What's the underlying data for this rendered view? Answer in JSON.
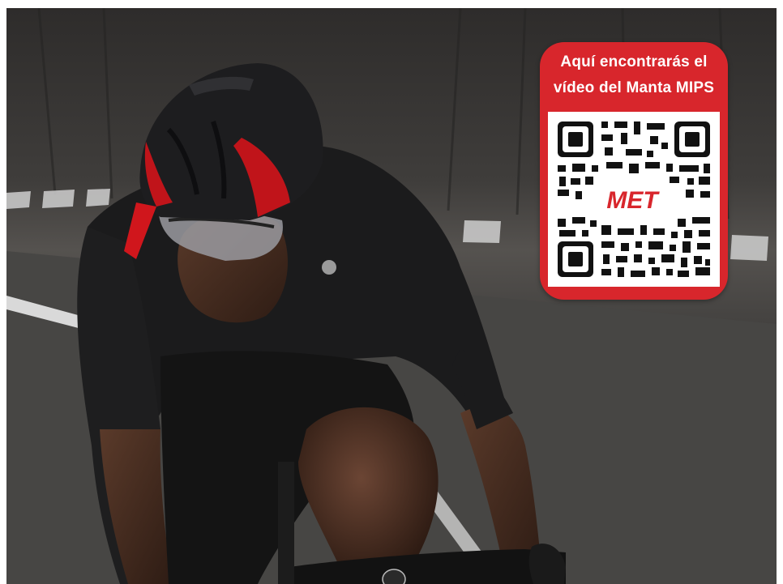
{
  "qr_card": {
    "line1": "Aquí encontrarás el",
    "line2": "vídeo del Manta MIPS",
    "logo_text": "MET",
    "background_color": "#d8262c"
  },
  "photo": {
    "subject": "cyclist-wearing-black-and-red-helmet"
  }
}
